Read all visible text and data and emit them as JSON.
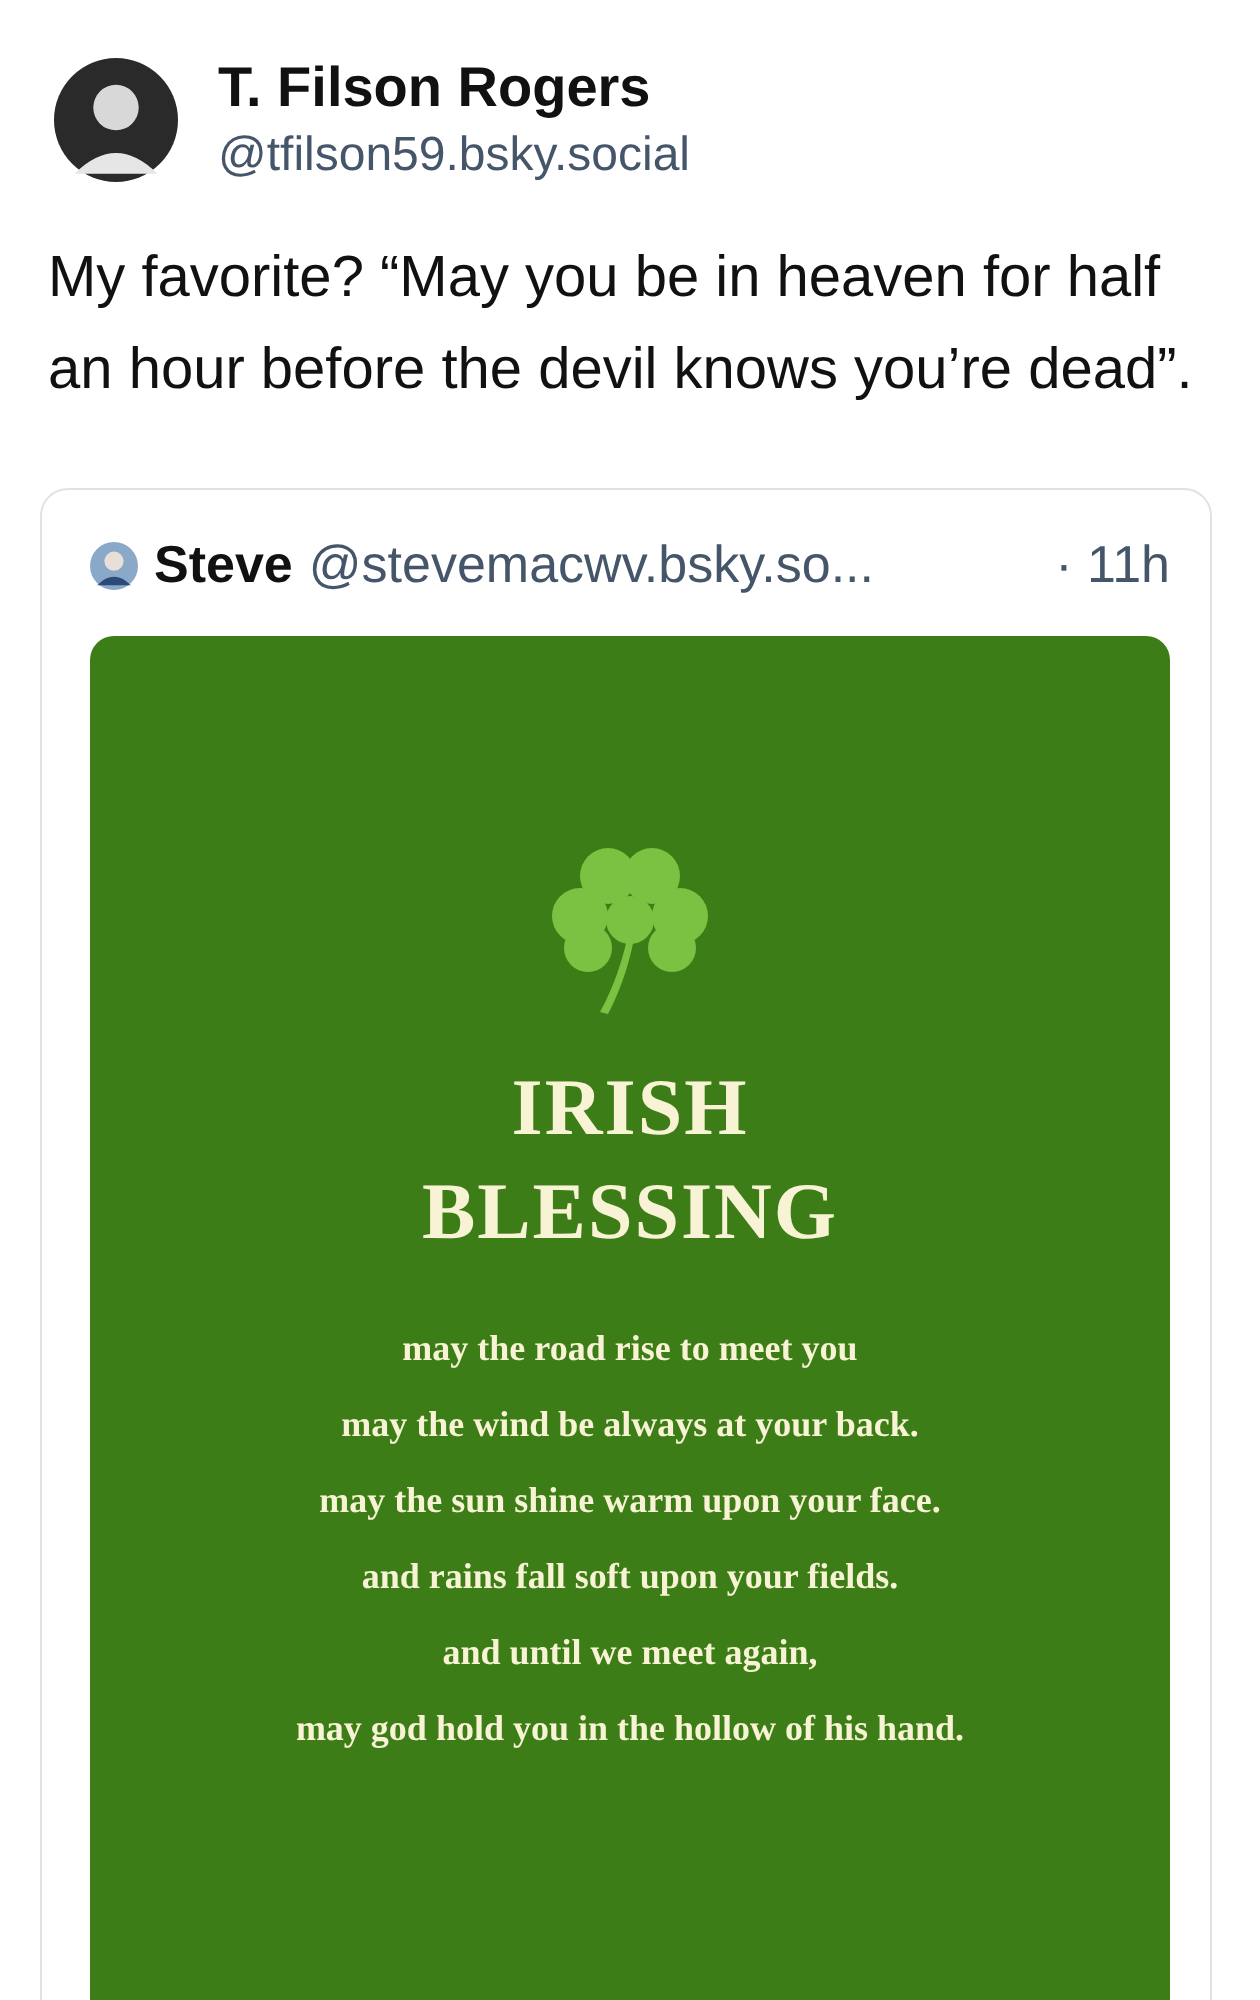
{
  "post": {
    "author": {
      "name": "T. Filson Rogers",
      "handle": "@tfilson59.bsky.social"
    },
    "text": "My favorite? “May you be in heaven for half an hour before the devil knows you’re dead”."
  },
  "quoted_post": {
    "author": {
      "name": "Steve",
      "handle": "@stevemacwv.bsky.so..."
    },
    "time": "· 11h",
    "image": {
      "title_lines": [
        "IRISH",
        "BLESSING"
      ],
      "lines": [
        "may the road rise to meet you",
        "may the wind be always at your back.",
        "may the sun shine warm upon your face.",
        "and rains fall soft upon your fields.",
        "and until we meet again,",
        "may god hold you in the hollow of his hand."
      ]
    }
  }
}
